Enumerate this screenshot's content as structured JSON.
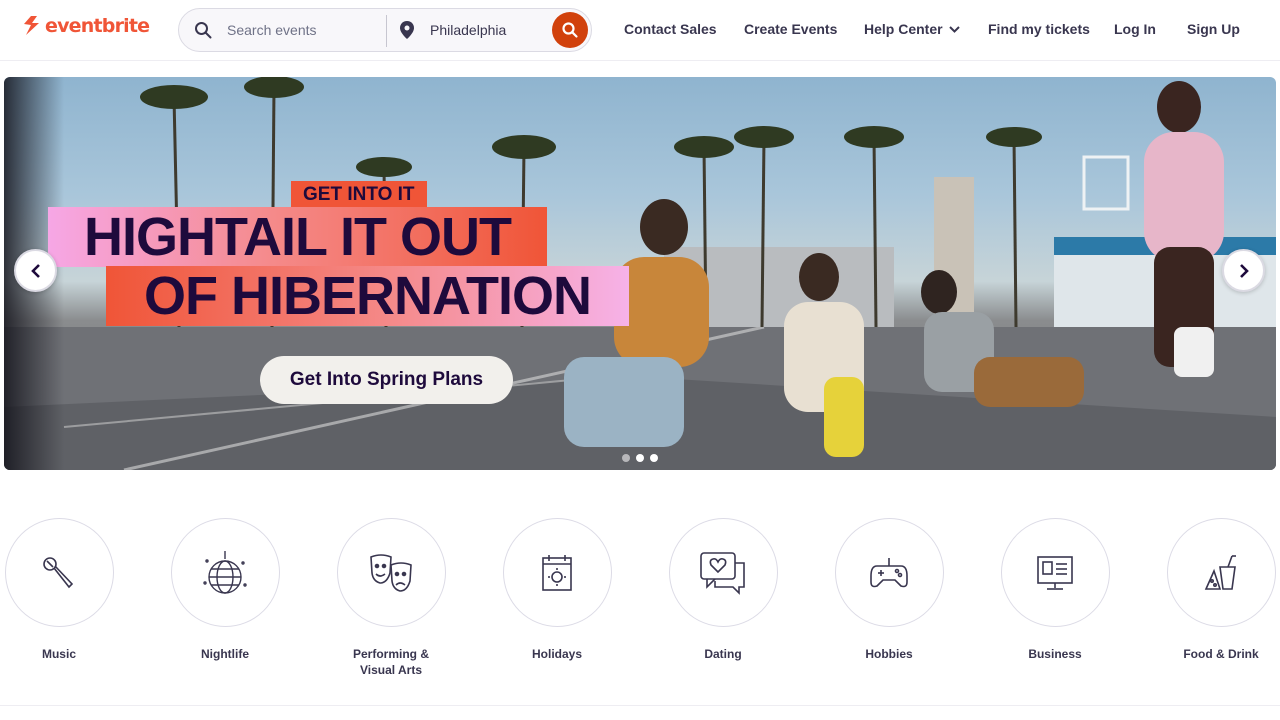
{
  "brand": {
    "logo_text": "eventbrite",
    "accent": "#f05537",
    "search_button_color": "#d1410c"
  },
  "search": {
    "placeholder": "Search events",
    "location": "Philadelphia"
  },
  "nav": {
    "contact_sales": "Contact Sales",
    "create_events": "Create Events",
    "help_center": "Help Center",
    "find_tickets": "Find my tickets",
    "log_in": "Log In",
    "sign_up": "Sign Up"
  },
  "hero": {
    "tag": "GET INTO IT",
    "headline_line1": "HIGHTAIL IT OUT",
    "headline_line2": "OF HIBERNATION",
    "cta": "Get Into Spring Plans",
    "slide_count": 3,
    "active_slide": 2,
    "prev_icon": "chevron-left-icon",
    "next_icon": "chevron-right-icon"
  },
  "categories": [
    {
      "label": "Music",
      "icon": "microphone-icon"
    },
    {
      "label": "Nightlife",
      "icon": "disco-ball-icon"
    },
    {
      "label": "Performing & Visual Arts",
      "icon": "theater-masks-icon"
    },
    {
      "label": "Holidays",
      "icon": "calendar-sun-icon"
    },
    {
      "label": "Dating",
      "icon": "chat-heart-icon"
    },
    {
      "label": "Hobbies",
      "icon": "game-controller-icon"
    },
    {
      "label": "Business",
      "icon": "presentation-board-icon"
    },
    {
      "label": "Food & Drink",
      "icon": "food-drink-icon"
    }
  ]
}
